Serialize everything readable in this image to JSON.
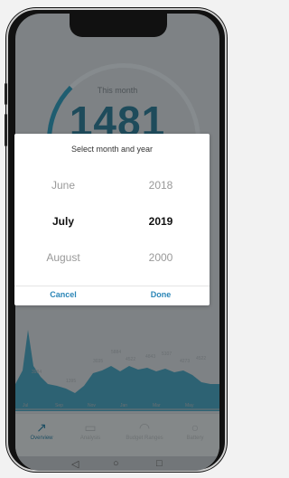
{
  "background": {
    "period_label": "This month",
    "total_value": "1481",
    "chart_data": {
      "type": "area",
      "x": [
        "Jul",
        "Sep",
        "Nov",
        "Jan",
        "Mar",
        "May"
      ],
      "values_labels": [
        "3984",
        "1395",
        "3035",
        "5884",
        "4522",
        "4843",
        "5107",
        "4273",
        "4522"
      ],
      "color": "#1f5d70"
    }
  },
  "bottom_nav": [
    {
      "label": "Overview",
      "icon": "chart-trend-icon"
    },
    {
      "label": "Analysis",
      "icon": "car-icon"
    },
    {
      "label": "Budget Ranges",
      "icon": "wifi-icon"
    },
    {
      "label": "Battery",
      "icon": "battery-icon"
    }
  ],
  "dialog": {
    "title": "Select month and year",
    "months": [
      "June",
      "July",
      "August"
    ],
    "years": [
      "2018",
      "2019",
      "2000"
    ],
    "selected_month": "July",
    "selected_year": "2019",
    "cancel_label": "Cancel",
    "done_label": "Done"
  },
  "colors": {
    "accent": "#2b86b7",
    "brand": "#1f5d70",
    "overlay": "#7e8285"
  }
}
